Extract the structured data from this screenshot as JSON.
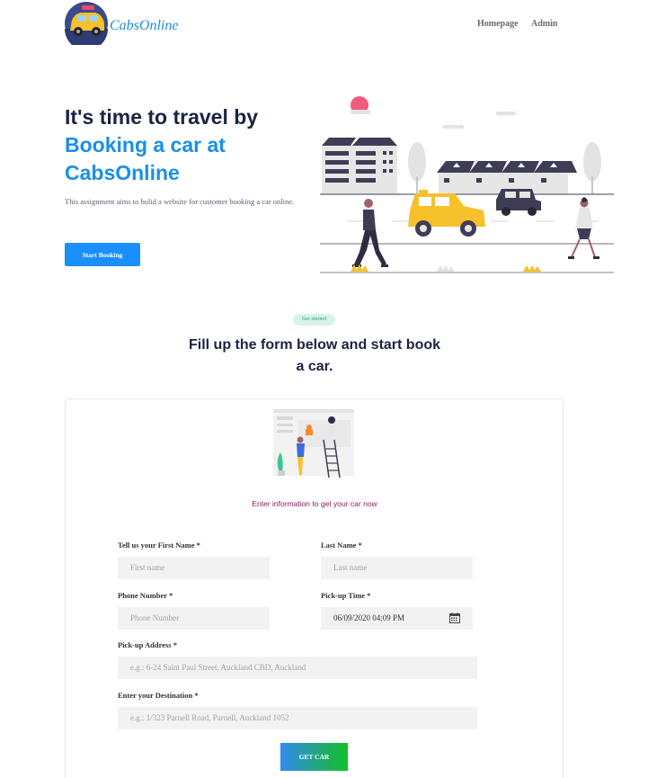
{
  "header": {
    "brand": "CabsOnline",
    "nav": [
      {
        "label": "Homepage"
      },
      {
        "label": "Admin"
      }
    ]
  },
  "hero": {
    "line1": "It's time to travel by",
    "line2": "Booking a car at",
    "line3": "CabsOnline",
    "description": "This assignment aims to bulid a website for customer booking a car online.",
    "cta": "Start Booking"
  },
  "section": {
    "badge": "Get started",
    "title": "Fill up the form below and start book a car."
  },
  "form": {
    "subtitle": "Enter information to get your car now",
    "first_name": {
      "label": "Tell us your First Name *",
      "placeholder": "First name"
    },
    "last_name": {
      "label": "Last Name *",
      "placeholder": "Last name"
    },
    "phone": {
      "label": "Phone Number *",
      "placeholder": "Phone Number"
    },
    "pickup_time": {
      "label": "Pick-up Time *",
      "value": "06/09/2020 04:09 PM"
    },
    "pickup_address": {
      "label": "Pick-up Address *",
      "placeholder": "e.g.: 6-24 Saint Paul Street, Auckland CBD, Auckland"
    },
    "destination": {
      "label": "Enter your Destination *",
      "placeholder": "e.g.: 1/323 Parnell Road, Parnell, Auckland 1052"
    },
    "submit": "GET CAR"
  },
  "colors": {
    "primary": "#1a8fff",
    "heading": "#1b2340",
    "accent_text": "#8a1c5a",
    "badge_bg": "#d8f3ea",
    "car_yellow": "#f6c12a"
  },
  "icons": [
    "taxi-logo-icon",
    "calendar-icon"
  ]
}
